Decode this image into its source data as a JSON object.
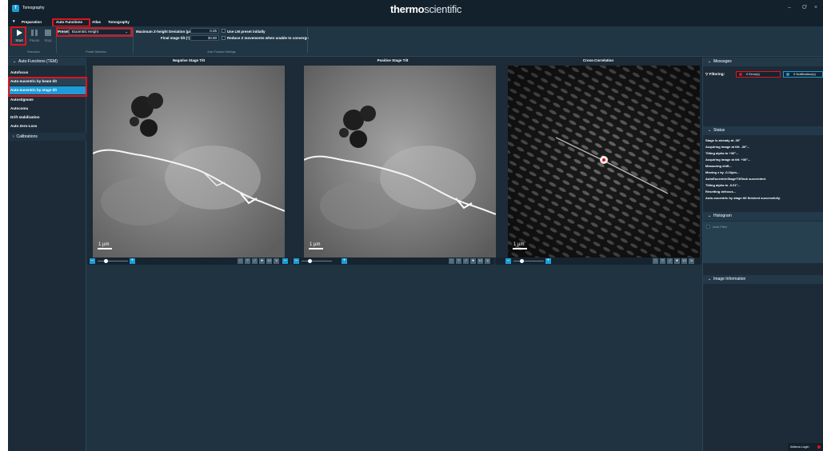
{
  "window": {
    "title": "Tomography",
    "brand_bold": "thermo",
    "brand_light": "scientific",
    "controls": [
      "–",
      "Ơ",
      "×"
    ]
  },
  "menu": {
    "items": [
      "Preparation",
      "Auto Functions",
      "Atlas",
      "Tomography"
    ],
    "active": "Auto Functions"
  },
  "ribbon": {
    "start_label": "Start",
    "pause_label": "Pause",
    "stop_label": "Stop",
    "execution_label": "Execution",
    "preset_label": "Presets",
    "preset_value": "Eucentric Height",
    "preset_selection_label": "Preset Selection",
    "max_z_label": "Maximum Z-height Deviation (µm)",
    "max_z_value": "0.25",
    "final_tilt_label": "Final stage tilt (°)",
    "final_tilt_value": "30.00",
    "use_lm_label": "Use LM preset initially",
    "reduce_z_label": "Reduce Z movements when unable to converge",
    "settings_label": "Auto Function Settings"
  },
  "left_panel": {
    "header": "Auto-Functions (TEM)",
    "items": [
      "Autofocus",
      "Auto-eucentric by beam tilt",
      "Auto-eucentric by stage tilt",
      "Autostigmate",
      "Autocoma",
      "Drift stabilization",
      "Auto Zero-Loss"
    ],
    "selected_index": 2,
    "calibrations": "Calibrations"
  },
  "panels": [
    {
      "title": "Negative Stage Tilt",
      "scale": "1 µm"
    },
    {
      "title": "Positive Stage Tilt",
      "scale": "1 µm"
    },
    {
      "title": "Cross-Correlation",
      "scale": "1 µm"
    }
  ],
  "toolbar_icons": [
    "crop-icon",
    "filter-icon",
    "fit-icon",
    "zoom-in-icon",
    "one-to-one-icon",
    "export-icon"
  ],
  "toolbar_ratio": "1:1",
  "right_panel": {
    "messages_header": "Messages",
    "filtering_label": "Filtering:",
    "errors_badge": "0 Error(s)",
    "notifications_badge": "0 Notification(s)",
    "status_header": "Status",
    "status_lines": [
      "Stage is already at -30°",
      "Acquiring image at tilt: -30°...",
      "Tilting alpha to +30°...",
      "Acquiring image at tilt: +30°...",
      "Measuring shift...",
      "Moving z by -0.16µm...",
      "AutoEucentricStageTiltTask succeeded.",
      "Tilting alpha to -0.01°...",
      "Resetting defocus...",
      "Auto-eucentric by stage tilt finished successfully."
    ],
    "histogram_header": "Histogram",
    "auto_filter_label": "Auto Filter",
    "image_info_header": "Image Information"
  },
  "statusbar": {
    "login_label": "Athena Login"
  },
  "colors": {
    "accent": "#1e9bd6",
    "highlight": "#e0141c",
    "background": "#1c2b37"
  }
}
